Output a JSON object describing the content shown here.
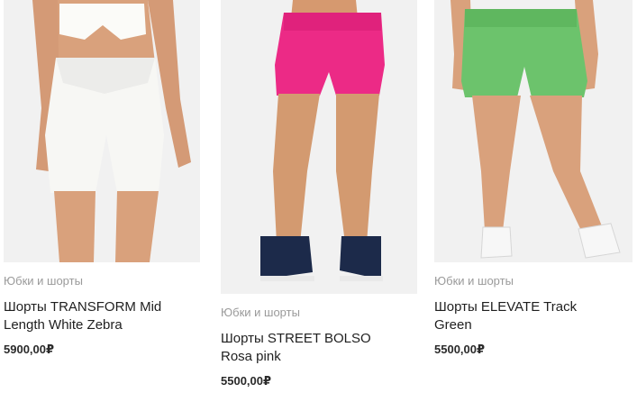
{
  "products": [
    {
      "category": "Юбки и шорты",
      "title_line1": "Шорты TRANSFORM Mid",
      "title_line2": "Length White Zebra",
      "price": "5900,00₽",
      "image_subject": "white-biker-shorts-photo"
    },
    {
      "category": "Юбки и шорты",
      "title_line1": "Шорты STREET BOLSO",
      "title_line2": "Rosa pink",
      "price": "5500,00₽",
      "image_subject": "pink-running-shorts-photo"
    },
    {
      "category": "Юбки и шорты",
      "title_line1": "Шорты ELEVATE Track",
      "title_line2": "Green",
      "price": "5500,00₽",
      "image_subject": "green-track-shorts-photo"
    }
  ],
  "colors": {
    "shorts_white": "#f7f7f4",
    "shorts_pink": "#ec2a86",
    "shorts_green": "#6cc36c",
    "skin": "#d9a17c",
    "sneaker_navy": "#1c2a4a"
  }
}
